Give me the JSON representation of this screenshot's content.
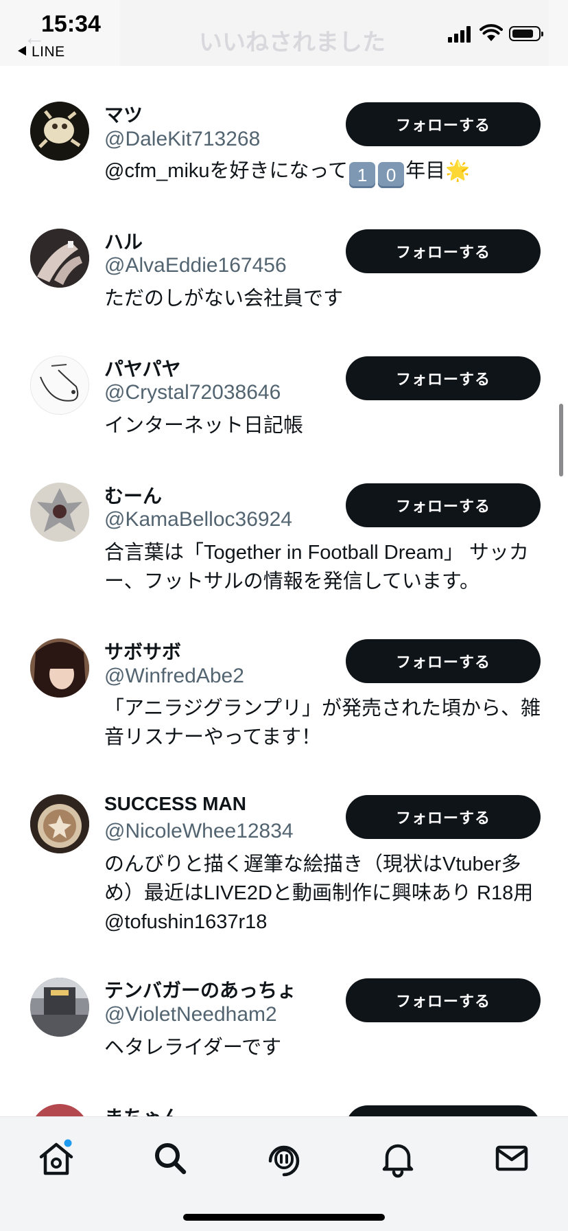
{
  "status_bar": {
    "time": "15:34",
    "back_app": "LINE"
  },
  "header": {
    "title": "いいねされました"
  },
  "follow_label": "フォローする",
  "users": [
    {
      "name": "マツ",
      "handle": "@DaleKit713268",
      "bio_prefix": "@cfm_mikuを好きになって",
      "bio_keycaps": [
        "1",
        "0"
      ],
      "bio_suffix": "年目",
      "bio_emoji": "🌟"
    },
    {
      "name": "ハル",
      "handle": "@AlvaEddie167456",
      "bio": "ただのしがない会社員です"
    },
    {
      "name": "パヤパヤ",
      "handle": "@Crystal72038646",
      "bio": "インターネット日記帳"
    },
    {
      "name": "むーん",
      "handle": "@KamaBelloc36924",
      "bio": "合言葉は「Together in Football Dream」 サッカー、フットサルの情報を発信しています。"
    },
    {
      "name": "サボサボ",
      "handle": "@WinfredAbe2",
      "bio": "「アニラジグランプリ」が発売された頃から、雑音リスナーやってます！"
    },
    {
      "name": "SUCCESS MAN",
      "handle": "@NicoleWhee12834",
      "bio": "のんびりと描く遅筆な絵描き（現状はVtuber多め）最近はLIVE2Dと動画制作に興味あり R18用 @tofushin1637r18"
    },
    {
      "name": "テンバガーのあっちょ",
      "handle": "@VioletNeedham2",
      "bio": "ヘタレライダーです"
    },
    {
      "name": "まちゃん",
      "handle": ""
    }
  ],
  "tabs": [
    {
      "name": "home",
      "icon": "home-icon",
      "has_dot": true
    },
    {
      "name": "search",
      "icon": "search-icon"
    },
    {
      "name": "spaces",
      "icon": "spaces-icon"
    },
    {
      "name": "notifications",
      "icon": "bell-icon"
    },
    {
      "name": "messages",
      "icon": "mail-icon"
    }
  ],
  "colors": {
    "button_bg": "#0f1419",
    "handle": "#536471",
    "badge_dot": "#1d9bf0"
  }
}
